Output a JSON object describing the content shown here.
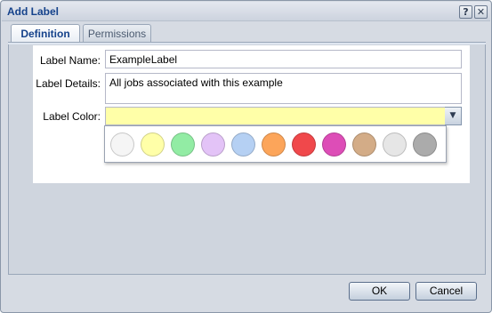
{
  "window": {
    "title": "Add Label",
    "help_glyph": "?",
    "close_glyph": "✕"
  },
  "tabs": [
    {
      "label": "Definition",
      "active": true
    },
    {
      "label": "Permissions",
      "active": false
    }
  ],
  "form": {
    "name_label": "Label Name:",
    "name_value": "ExampleLabel",
    "details_label": "Label Details:",
    "details_value": "All jobs associated with this example",
    "color_label": "Label Color:",
    "color_value": "#ffffa8",
    "dropdown_glyph": "▼"
  },
  "palette": {
    "colors": [
      {
        "name": "white",
        "hex": "#f5f5f5"
      },
      {
        "name": "yellow",
        "hex": "#ffffa8"
      },
      {
        "name": "green",
        "hex": "#92eca4"
      },
      {
        "name": "lavender",
        "hex": "#e3c3f7"
      },
      {
        "name": "light-blue",
        "hex": "#b5d0f3"
      },
      {
        "name": "orange",
        "hex": "#fca55a"
      },
      {
        "name": "red",
        "hex": "#f0484b"
      },
      {
        "name": "magenta",
        "hex": "#dd4db7"
      },
      {
        "name": "tan",
        "hex": "#d3ac87"
      },
      {
        "name": "light-gray",
        "hex": "#e6e6e6"
      },
      {
        "name": "gray",
        "hex": "#ababab"
      }
    ]
  },
  "buttons": {
    "ok": "OK",
    "cancel": "Cancel"
  }
}
